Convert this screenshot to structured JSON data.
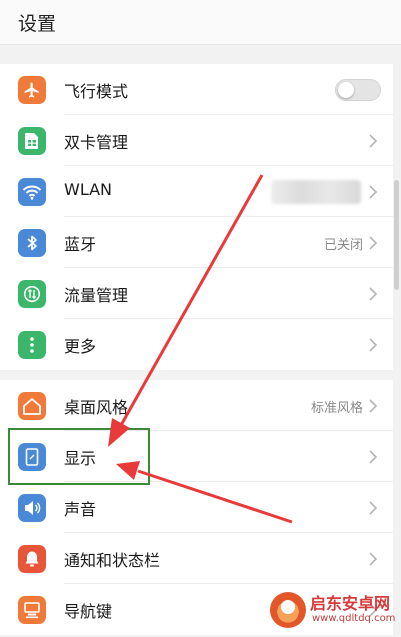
{
  "header": {
    "title": "设置"
  },
  "group1": [
    {
      "label": "飞行模式",
      "icon": "airplane-icon",
      "color": "#f07a3a",
      "control": "toggle",
      "toggle_on": false
    },
    {
      "label": "双卡管理",
      "icon": "sim-card-icon",
      "color": "#3cb66a",
      "control": "chevron"
    },
    {
      "label": "WLAN",
      "icon": "wifi-icon",
      "color": "#4a88d8",
      "control": "chevron"
    },
    {
      "label": "蓝牙",
      "icon": "bluetooth-icon",
      "color": "#4a88d8",
      "control": "chevron",
      "value": "已关闭"
    },
    {
      "label": "流量管理",
      "icon": "data-usage-icon",
      "color": "#3cb66a",
      "control": "chevron"
    },
    {
      "label": "更多",
      "icon": "more-dots-icon",
      "color": "#3cb66a",
      "control": "chevron"
    }
  ],
  "group2": [
    {
      "label": "桌面风格",
      "icon": "home-style-icon",
      "color": "#f07a3a",
      "control": "chevron",
      "value": "标准风格"
    },
    {
      "label": "显示",
      "icon": "display-icon",
      "color": "#4a88d8",
      "control": "chevron"
    },
    {
      "label": "声音",
      "icon": "speaker-icon",
      "color": "#4a88d8",
      "control": "chevron"
    },
    {
      "label": "通知和状态栏",
      "icon": "bell-icon",
      "color": "#e8563a",
      "control": "chevron"
    },
    {
      "label": "导航键",
      "icon": "navigation-key-icon",
      "color": "#f07a3a",
      "control": "chevron"
    }
  ],
  "annotations": {
    "arrow_color": "#e83a3a",
    "highlight_color": "#3a8a3a"
  },
  "watermark": {
    "name": "启东安卓网",
    "url": "www.qdltdq.com"
  }
}
